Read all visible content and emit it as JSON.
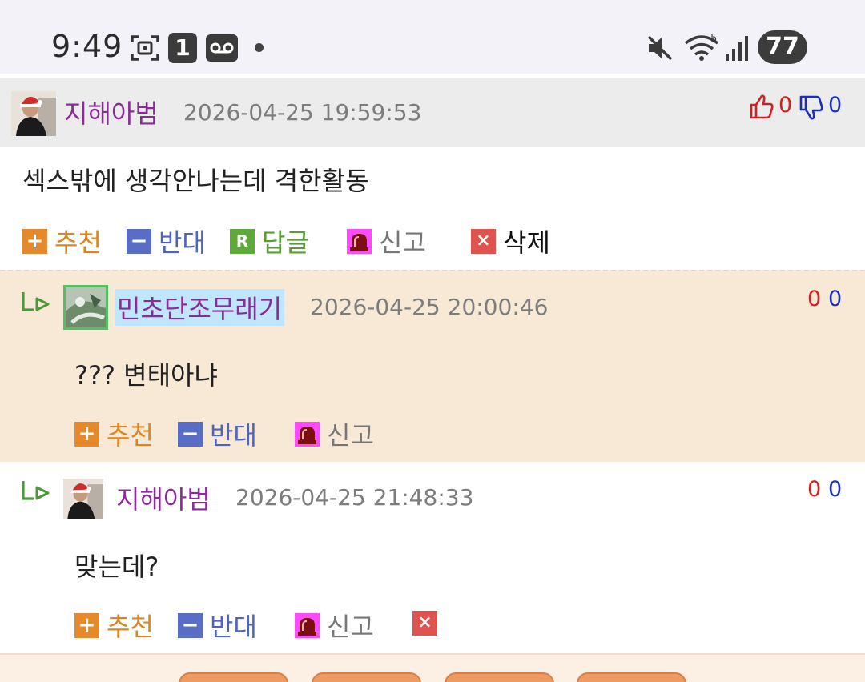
{
  "status_bar": {
    "time": "9:49",
    "notification_count": "1",
    "battery": "77"
  },
  "comments": [
    {
      "nickname": "지해아범",
      "date": "2026-04-25 19:59:53",
      "text": "섹스밖에 생각안나는데 격한활동",
      "upvotes": "0",
      "downvotes": "0",
      "actions": {
        "recommend": "추천",
        "oppose": "반대",
        "reply": "답글",
        "report": "신고",
        "delete": "삭제"
      }
    },
    {
      "nickname": "민초단조무래기",
      "date": "2026-04-25 20:00:46",
      "text": "??? 변태아냐",
      "upvotes": "0",
      "downvotes": "0",
      "actions": {
        "recommend": "추천",
        "oppose": "반대",
        "report": "신고"
      }
    },
    {
      "nickname": "지해아범",
      "date": "2026-04-25 21:48:33",
      "text": "맞는데?",
      "upvotes": "0",
      "downvotes": "0",
      "actions": {
        "recommend": "추천",
        "oppose": "반대",
        "report": "신고"
      }
    }
  ],
  "icons": {
    "plus": "+",
    "minus": "−",
    "reply": "R",
    "delete": "×"
  },
  "colors": {
    "nickname": "#8a2c97",
    "up": "#d02020",
    "down": "#1a2fb3",
    "reply_bg": "#f8e8d6"
  }
}
